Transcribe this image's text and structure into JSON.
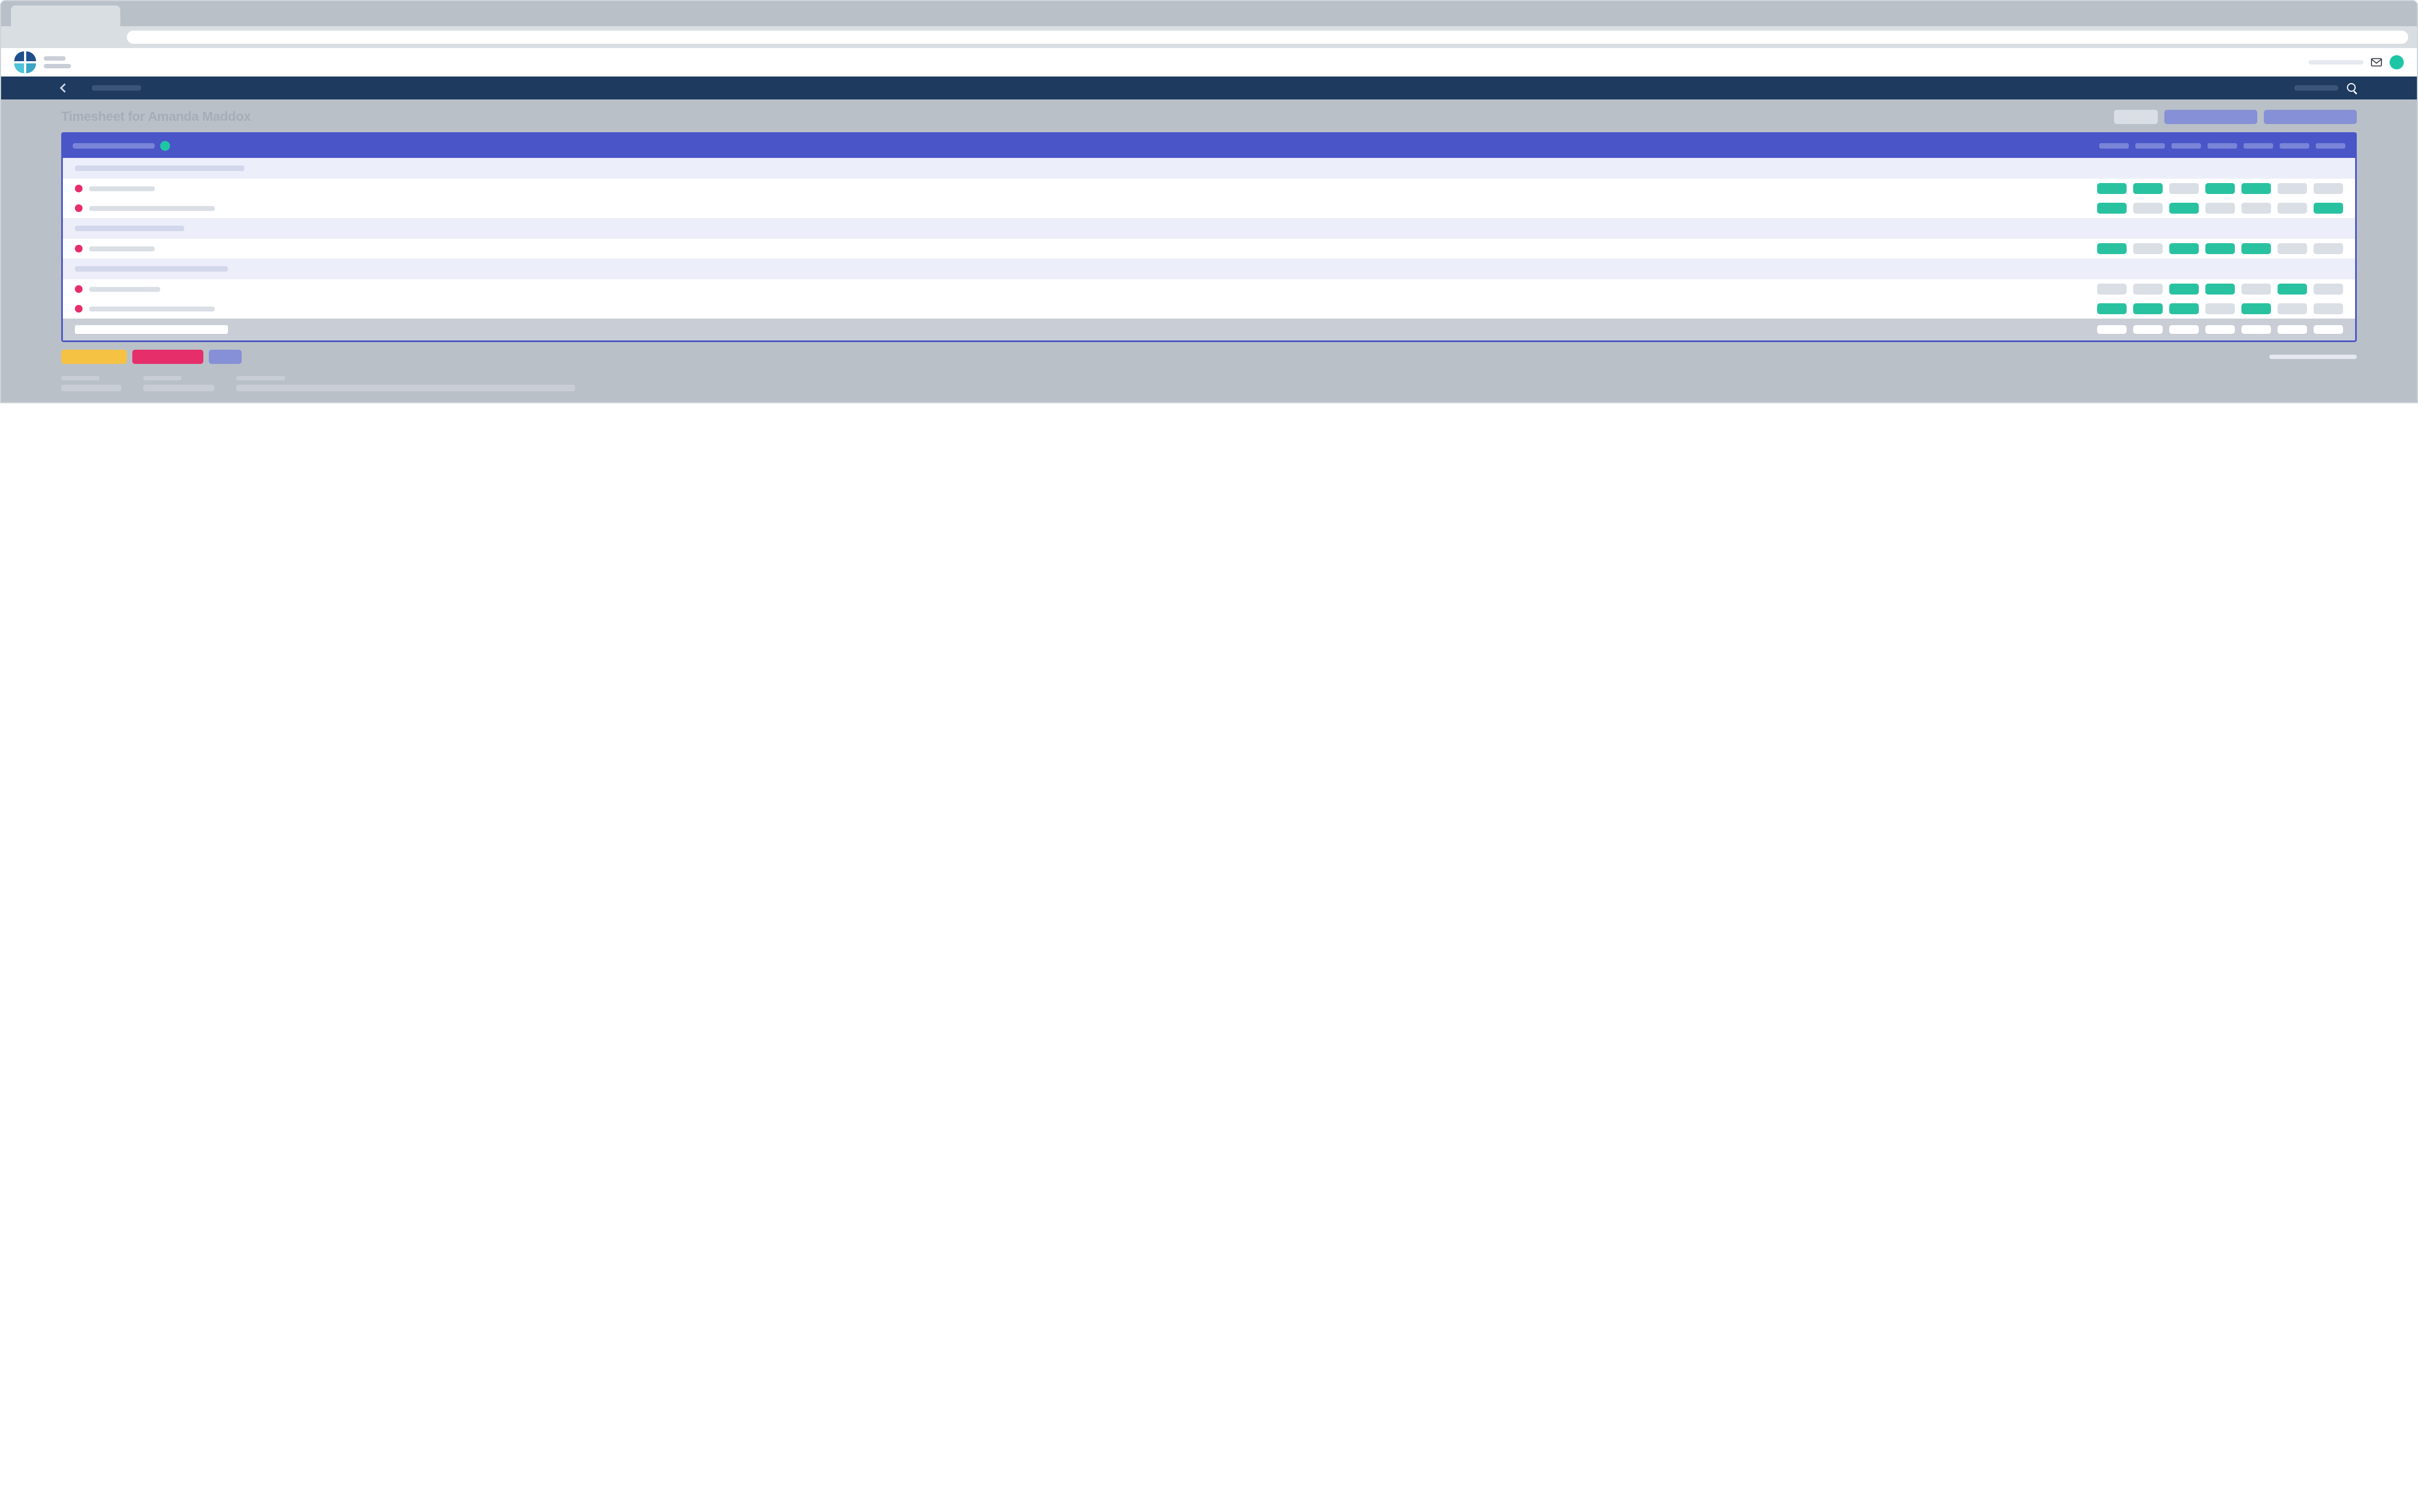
{
  "page_title": "Timesheet for Amanda Maddox",
  "header": {
    "app_name": "",
    "app_sub": "",
    "user_ph": ""
  },
  "nav": {
    "breadcrumb": "",
    "search_ph": ""
  },
  "title_actions": {
    "secondary_label": "",
    "primary1_label": "",
    "primary2_label": ""
  },
  "timesheet": {
    "period_label": "",
    "days": [
      "",
      "",
      "",
      "",
      "",
      "",
      ""
    ],
    "groups": [
      {
        "name": "",
        "tasks": [
          {
            "label": "",
            "cells": [
              "on",
              "on",
              "off",
              "on",
              "on",
              "off",
              "off"
            ]
          },
          {
            "label": "",
            "cells": [
              "on",
              "off",
              "on",
              "off",
              "off",
              "off",
              "on"
            ]
          }
        ]
      },
      {
        "name": "",
        "tasks": [
          {
            "label": "",
            "cells": [
              "on",
              "off",
              "on",
              "on",
              "on",
              "off",
              "off"
            ]
          }
        ]
      },
      {
        "name": "",
        "tasks": [
          {
            "label": "",
            "cells": [
              "off",
              "off",
              "on",
              "on",
              "off",
              "on",
              "off"
            ]
          },
          {
            "label": "",
            "cells": [
              "on",
              "on",
              "on",
              "off",
              "on",
              "off",
              "off"
            ]
          }
        ]
      }
    ],
    "totals": [
      "",
      "",
      "",
      "",
      "",
      "",
      ""
    ]
  },
  "actions": {
    "yellow": "",
    "pink": "",
    "purple": "",
    "right_link": ""
  },
  "footer_cols": [
    {
      "h": "",
      "l": ""
    },
    {
      "h": "",
      "l": ""
    },
    {
      "h": "",
      "l": ""
    }
  ]
}
